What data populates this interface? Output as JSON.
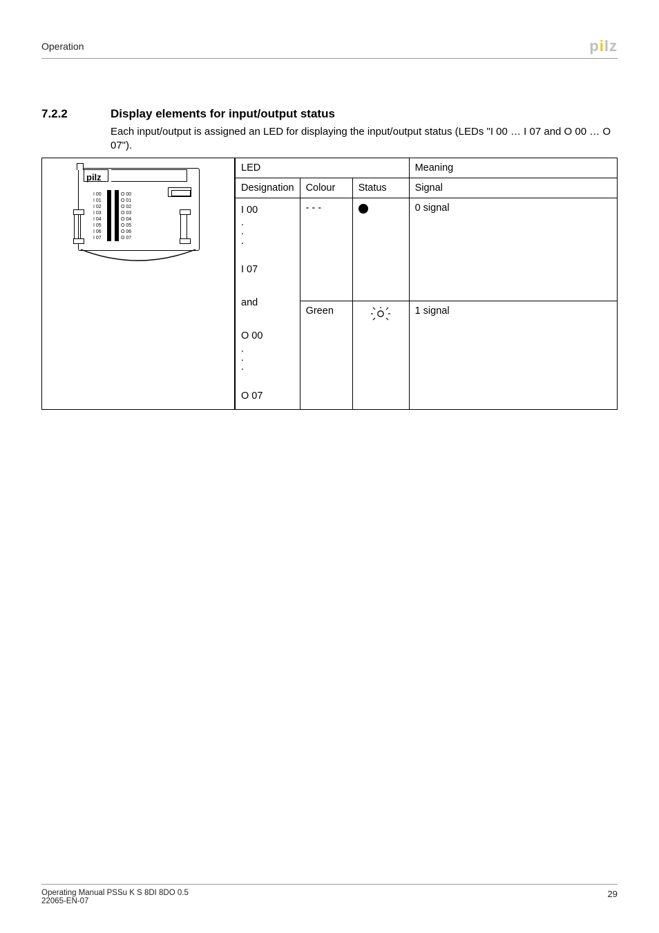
{
  "header": {
    "section": "Operation",
    "logo_main": "p lz",
    "logo_dot": "i"
  },
  "sec": {
    "num": "7.2.2",
    "title": "Display elements for input/output status",
    "body": "Each input/output is assigned an LED for displaying the input/output status (LEDs \"I 00 … I 07 and O 00 … O 07\")."
  },
  "device": {
    "brand": "pilz",
    "left_labels": [
      "I 00",
      "I 01",
      "I 02",
      "I 03",
      "I 04",
      "I 05",
      "I 06",
      "I 07"
    ],
    "right_labels": [
      "O 00",
      "O 01",
      "O 02",
      "O 03",
      "O 04",
      "O 05",
      "O 06",
      "O 07"
    ]
  },
  "table": {
    "led_hdr": "LED",
    "meaning_hdr": "Meaning",
    "sub": {
      "designation": "Designation",
      "colour": "Colour",
      "status": "Status",
      "signal": "Signal"
    },
    "rows": [
      {
        "colour": "- - -",
        "meaning": "0 signal",
        "status": "off"
      },
      {
        "colour": "Green",
        "meaning": "1 signal",
        "status": "on"
      }
    ],
    "des_lines": [
      "I 00",
      ".",
      ".",
      ".",
      "",
      "I 07",
      "",
      "and",
      "",
      "O 00",
      ".",
      ".",
      ".",
      "",
      "O 07"
    ]
  },
  "footer": {
    "l1": "Operating Manual PSSu K S 8DI 8DO 0.5",
    "l2": "22065-EN-07",
    "page": "29"
  }
}
